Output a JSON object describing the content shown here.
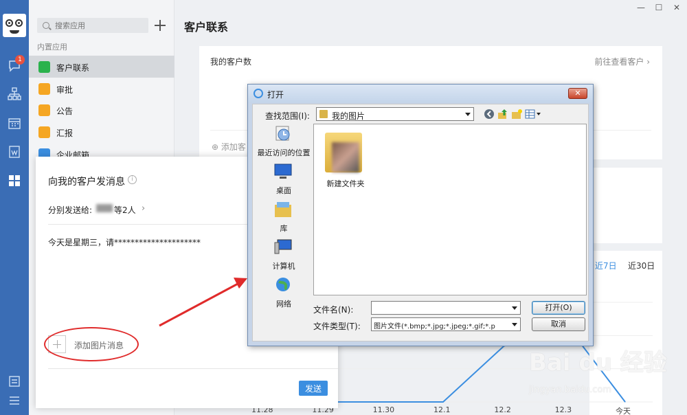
{
  "window": {
    "min": "—",
    "max": "☐",
    "close": "✕"
  },
  "rail": {
    "badge": "1"
  },
  "sidebar": {
    "search_placeholder": "搜索应用",
    "section": "内置应用",
    "items": [
      {
        "label": "客户联系",
        "color": "#2bb24c"
      },
      {
        "label": "审批",
        "color": "#f5a623"
      },
      {
        "label": "公告",
        "color": "#f5a623"
      },
      {
        "label": "汇报",
        "color": "#f5a623"
      },
      {
        "label": "企业邮箱",
        "color": "#3b8ee0"
      }
    ]
  },
  "main": {
    "title": "客户联系",
    "card1_title": "我的客户数",
    "card1_link": "前往查看客户",
    "card1_add": "添加客",
    "range_7": "近7日",
    "range_30": "近30日"
  },
  "compose": {
    "title": "向我的客户发消息",
    "send_to_label": "分别发送给:",
    "send_to_count": "等2人",
    "message": "今天是星期三，请*********************",
    "add_image": "添加图片消息",
    "send": "发送"
  },
  "dialog": {
    "title": "打开",
    "look_in_label": "查找范围(I):",
    "look_in_value": "我的图片",
    "places": [
      "最近访问的位置",
      "桌面",
      "库",
      "计算机",
      "网络"
    ],
    "folder_name": "新建文件夹",
    "filename_label": "文件名(N):",
    "filename_value": "",
    "filetype_label": "文件类型(T):",
    "filetype_value": "图片文件(*.bmp;*.jpg;*.jpeg;*.gif;*.p",
    "open": "打开(O)",
    "cancel": "取消"
  },
  "chart_data": {
    "type": "line",
    "categories": [
      "11.28",
      "11.29",
      "11.30",
      "12.1",
      "12.2",
      "12.3",
      "今天"
    ],
    "values": [
      0,
      0,
      0,
      0,
      1.4,
      2,
      0
    ],
    "ylim": [
      0,
      2.5
    ],
    "grid": true,
    "color": "#3b8ee0"
  },
  "watermark": {
    "main": "Bai du 经验",
    "sub": "jingyan.baidu.com"
  }
}
